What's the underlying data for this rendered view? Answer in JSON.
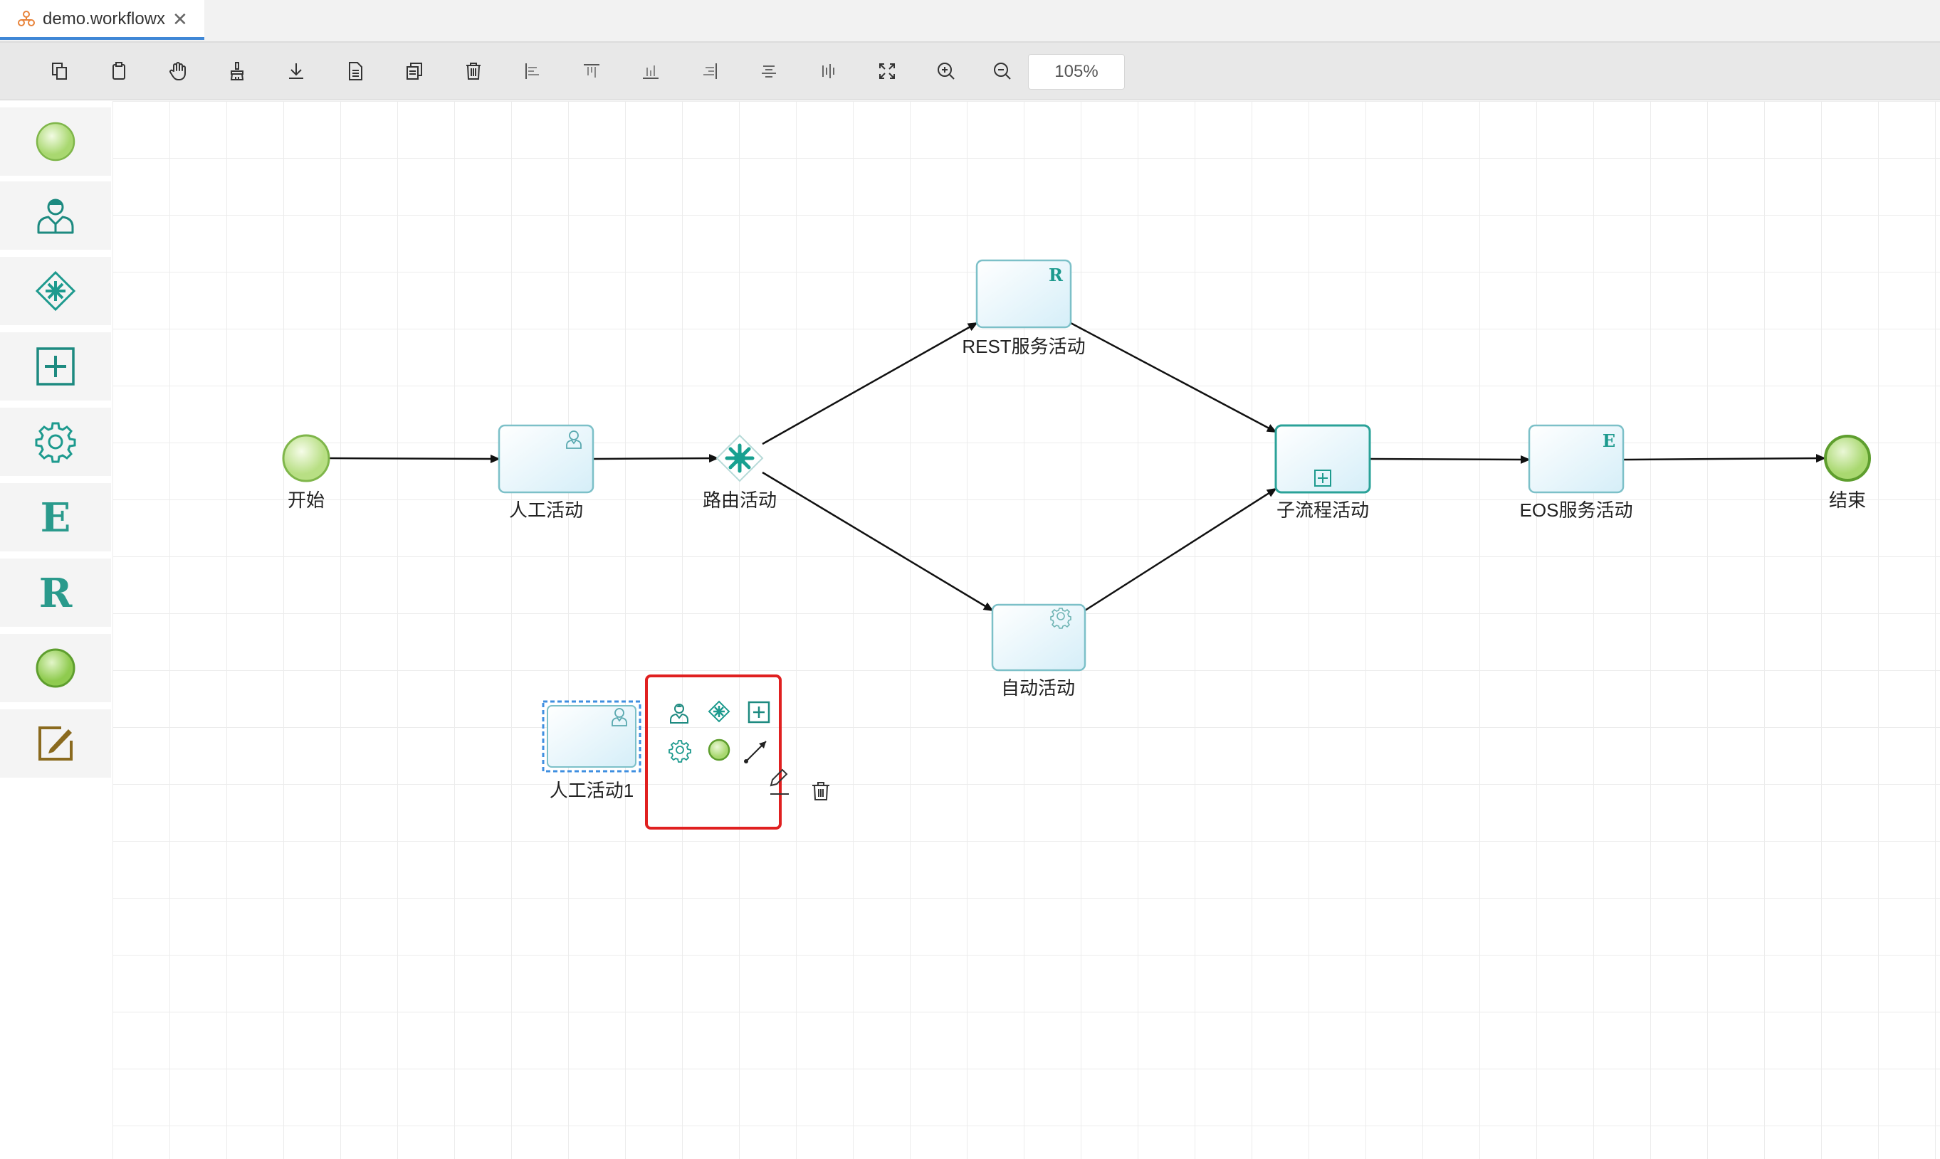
{
  "tab": {
    "title": "demo.workflowx",
    "close": "✕"
  },
  "toolbar": {
    "zoom": "105%",
    "buttons": [
      "copy",
      "paste",
      "hand",
      "clear",
      "download",
      "document",
      "duplicate",
      "delete",
      "align-left",
      "align-top",
      "align-bottom",
      "align-right",
      "align-center",
      "align-middle",
      "fit",
      "zoom-in",
      "zoom-out"
    ]
  },
  "palette": {
    "items": [
      "start-event",
      "manual-activity",
      "route-activity",
      "subprocess-activity",
      "auto-activity",
      "eos-service-activity",
      "rest-service-activity",
      "end-event",
      "note"
    ]
  },
  "diagram": {
    "nodes": {
      "start": {
        "label": "开始"
      },
      "manual": {
        "label": "人工活动"
      },
      "route": {
        "label": "路由活动"
      },
      "rest": {
        "label": "REST服务活动",
        "badge": "R"
      },
      "auto": {
        "label": "自动活动"
      },
      "sub": {
        "label": "子流程活动"
      },
      "eos": {
        "label": "EOS服务活动",
        "badge": "E"
      },
      "end": {
        "label": "结束"
      },
      "manual1": {
        "label": "人工活动1"
      }
    }
  },
  "palette_glyphs": {
    "eos": "E",
    "rest": "R"
  },
  "colors": {
    "accent": "#1d9a8e",
    "event_fill": "#c5e69a",
    "event_stroke": "#7fb64a",
    "selection": "#e02020",
    "tab_underline": "#3f87d6"
  }
}
